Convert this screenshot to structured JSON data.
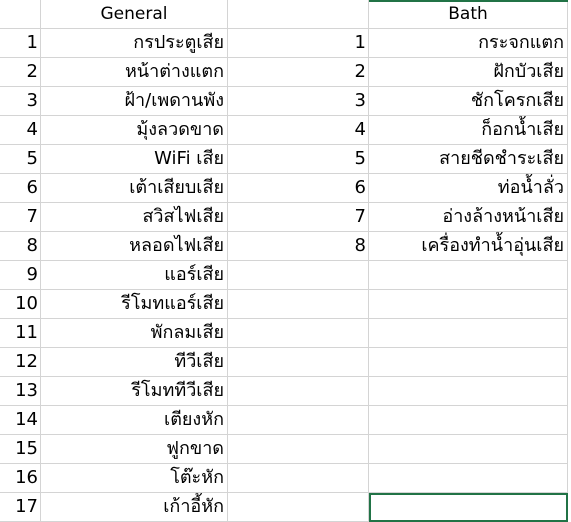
{
  "header": {
    "general": "General",
    "bath": "Bath"
  },
  "rows": [
    {
      "gn": "1",
      "gt": "กรประตูเสีย",
      "bn": "1",
      "bt": "กระจกแตก"
    },
    {
      "gn": "2",
      "gt": "หน้าต่างแตก",
      "bn": "2",
      "bt": "ฝักบัวเสีย"
    },
    {
      "gn": "3",
      "gt": "ฝ้า/เพดานพัง",
      "bn": "3",
      "bt": "ชักโครกเสีย"
    },
    {
      "gn": "4",
      "gt": "มุ้งลวดขาด",
      "bn": "4",
      "bt": "ก็อกน้ำเสีย"
    },
    {
      "gn": "5",
      "gt": "WiFi เสีย",
      "bn": "5",
      "bt": "สายชีดชำระเสีย"
    },
    {
      "gn": "6",
      "gt": "เต้าเสียบเสีย",
      "bn": "6",
      "bt": "ท่อน้ำลั่ว"
    },
    {
      "gn": "7",
      "gt": "สวิสไฟเสีย",
      "bn": "7",
      "bt": "อ่างล้างหน้าเสีย"
    },
    {
      "gn": "8",
      "gt": "หลอดไฟเสีย",
      "bn": "8",
      "bt": "เครื่องทำน้ำอุ่นเสีย"
    },
    {
      "gn": "9",
      "gt": "แอร์เสีย",
      "bn": "",
      "bt": ""
    },
    {
      "gn": "10",
      "gt": "รีโมทแอร์เสีย",
      "bn": "",
      "bt": ""
    },
    {
      "gn": "11",
      "gt": "พักลมเสีย",
      "bn": "",
      "bt": ""
    },
    {
      "gn": "12",
      "gt": "ทีวีเสีย",
      "bn": "",
      "bt": ""
    },
    {
      "gn": "13",
      "gt": "รีโมททีวีเสีย",
      "bn": "",
      "bt": ""
    },
    {
      "gn": "14",
      "gt": "เตียงหัก",
      "bn": "",
      "bt": ""
    },
    {
      "gn": "15",
      "gt": "ฟูกขาด",
      "bn": "",
      "bt": ""
    },
    {
      "gn": "16",
      "gt": "โต๊ะหัก",
      "bn": "",
      "bt": ""
    },
    {
      "gn": "17",
      "gt": "เก้าอี้หัก",
      "bn": "",
      "bt": ""
    }
  ],
  "colors": {
    "gridline": "#d4d4d4",
    "selection": "#217346"
  }
}
